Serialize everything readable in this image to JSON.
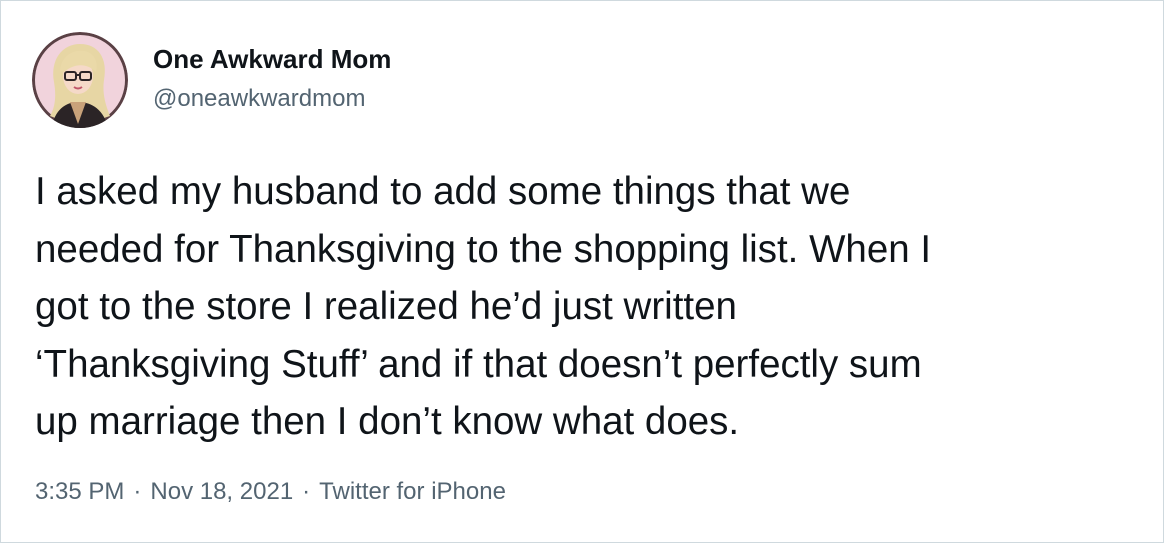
{
  "author": {
    "display_name": "One Awkward Mom",
    "handle": "@oneawkwardmom"
  },
  "tweet": {
    "lines": [
      "I asked my husband to add some things that we",
      "needed for Thanksgiving to the shopping list. When I",
      "got to the store I realized he’d just written",
      "‘Thanksgiving Stuff’ and if that doesn’t perfectly sum",
      "up marriage then I don’t know what does."
    ]
  },
  "meta": {
    "time": "3:35 PM",
    "separator": "·",
    "date": "Nov 18, 2021",
    "source": "Twitter for iPhone"
  },
  "colors": {
    "text_primary": "#0f1419",
    "text_secondary": "#536471",
    "border": "#cfd9de",
    "avatar_bg": "#f1d3dc"
  }
}
